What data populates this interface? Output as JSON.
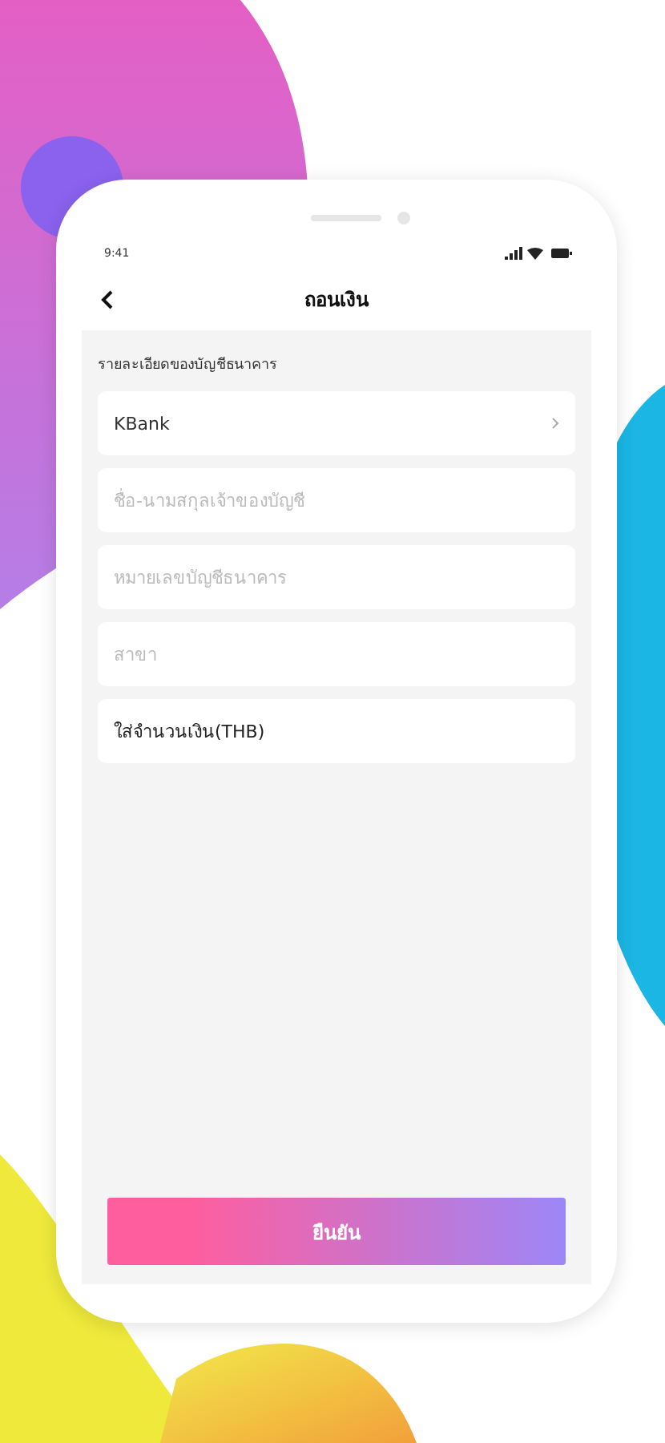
{
  "status_bar": {
    "time": "9:41"
  },
  "header": {
    "title": "ถอนเงิน"
  },
  "section": {
    "title": "รายละเอียดของบัญชีธนาคาร"
  },
  "fields": [
    {
      "kind": "select",
      "value": "KBank"
    },
    {
      "kind": "input",
      "placeholder": "ชื่อ-นามสกุลเจ้าของบัญชี"
    },
    {
      "kind": "input",
      "placeholder": "หมายเลขบัญชีธนาคาร"
    },
    {
      "kind": "input",
      "placeholder": "สาขา"
    },
    {
      "kind": "input",
      "value": "ใส่จำนวนเงิน(THB)"
    }
  ],
  "confirm_button": {
    "label": "ยืนยัน"
  }
}
